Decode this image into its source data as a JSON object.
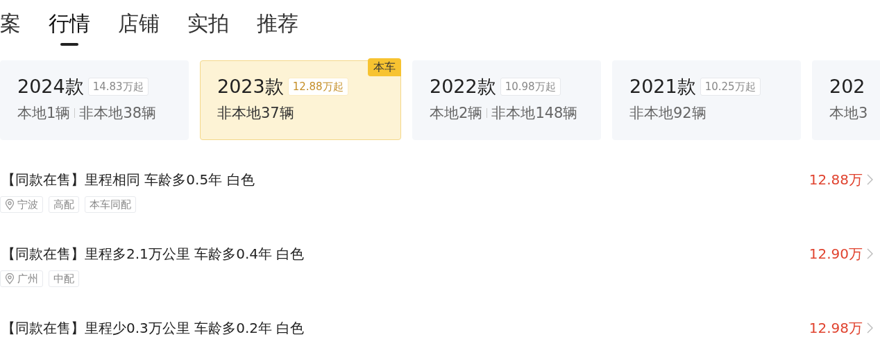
{
  "tabs": [
    {
      "label": "案",
      "selected": false
    },
    {
      "label": "行情",
      "selected": true
    },
    {
      "label": "店铺",
      "selected": false
    },
    {
      "label": "实拍",
      "selected": false
    },
    {
      "label": "推荐",
      "selected": false
    }
  ],
  "models": [
    {
      "year": "2024款",
      "price": "14.83万起",
      "counts": [
        "本地1辆",
        "非本地38辆"
      ],
      "selected": false
    },
    {
      "year": "2023款",
      "price": "12.88万起",
      "counts": [
        "非本地37辆"
      ],
      "selected": true,
      "badge": "本车"
    },
    {
      "year": "2022款",
      "price": "10.98万起",
      "counts": [
        "本地2辆",
        "非本地148辆"
      ],
      "selected": false
    },
    {
      "year": "2021款",
      "price": "10.25万起",
      "counts": [
        "非本地92辆"
      ],
      "selected": false
    },
    {
      "year": "202",
      "counts": [
        "本地3"
      ],
      "selected": false
    }
  ],
  "listings": [
    {
      "title": "【同款在售】里程相同 车龄多0.5年 白色",
      "price": "12.88万",
      "location": "宁波",
      "tags": [
        "高配",
        "本车同配"
      ]
    },
    {
      "title": "【同款在售】里程多2.1万公里 车龄多0.4年 白色",
      "price": "12.90万",
      "location": "广州",
      "tags": [
        "中配"
      ]
    },
    {
      "title": "【同款在售】里程少0.3万公里 车龄多0.2年 白色",
      "price": "12.98万"
    }
  ]
}
